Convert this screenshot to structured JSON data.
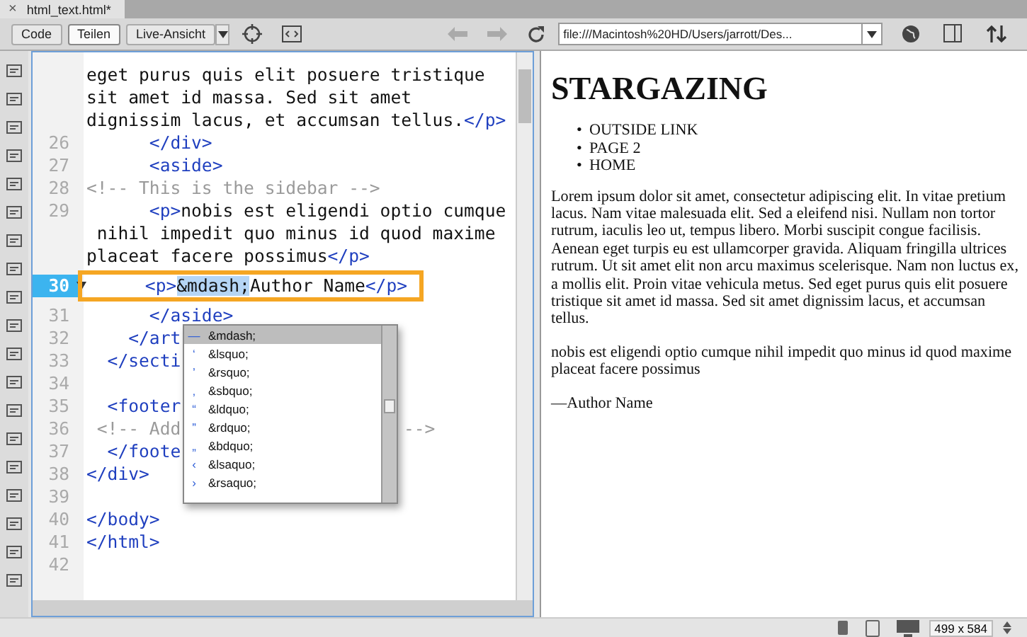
{
  "tab": {
    "close": "×",
    "title": "html_text.html*"
  },
  "toolbar": {
    "buttons": [
      {
        "label": "Code",
        "selected": false
      },
      {
        "label": "Teilen",
        "selected": true
      },
      {
        "label": "Live-Ansicht",
        "selected": false
      }
    ],
    "address": "file:///Macintosh%20HD/Users/jarrott/Des..."
  },
  "code": {
    "lines": [
      {
        "current": false,
        "segments": [
          {
            "kind": "text",
            "text": "eget purus quis elit posuere tristique"
          }
        ]
      },
      {
        "current": false,
        "segments": [
          {
            "kind": "text",
            "text": "sit amet id massa. Sed sit amet"
          }
        ]
      },
      {
        "current": false,
        "segments": [
          {
            "kind": "text",
            "text": "dignissim lacus, et accumsan tellus."
          },
          {
            "kind": "tag",
            "text": "</p>"
          }
        ]
      },
      {
        "number": "26",
        "current": false,
        "segments": [
          {
            "kind": "tag",
            "text": "      </div>"
          }
        ]
      },
      {
        "number": "27",
        "current": false,
        "segments": [
          {
            "kind": "tag",
            "text": "      <aside>"
          }
        ]
      },
      {
        "number": "28",
        "current": false,
        "segments": [
          {
            "kind": "comment",
            "text": "<!-- This is the sidebar -->"
          }
        ]
      },
      {
        "number": "29",
        "current": false,
        "segments": [
          {
            "kind": "tag",
            "text": "      <p>"
          },
          {
            "kind": "text",
            "text": "nobis est eligendi optio cumque"
          }
        ]
      },
      {
        "current": false,
        "segments": [
          {
            "kind": "text",
            "text": " nihil impedit quo minus id quod maxime"
          }
        ]
      },
      {
        "current": false,
        "segments": [
          {
            "kind": "text",
            "text": "placeat facere possimus"
          },
          {
            "kind": "tag",
            "text": "</p>"
          }
        ]
      },
      {
        "number": "30",
        "current": true,
        "boxed": true,
        "segments": [
          {
            "kind": "tag",
            "text": "      <p>"
          },
          {
            "kind": "selection",
            "text": "&mdash;"
          },
          {
            "kind": "text",
            "text": "Author Name"
          },
          {
            "kind": "tag",
            "text": "</p>"
          }
        ]
      },
      {
        "number": "31",
        "current": false,
        "segments": [
          {
            "kind": "tag",
            "text": "      </aside>"
          }
        ]
      },
      {
        "number": "32",
        "current": false,
        "segments": [
          {
            "kind": "tag",
            "text": "    </art"
          }
        ]
      },
      {
        "number": "33",
        "current": false,
        "segments": [
          {
            "kind": "tag",
            "text": "  </secti"
          }
        ]
      },
      {
        "number": "34",
        "current": false
      },
      {
        "number": "35",
        "current": false,
        "segments": [
          {
            "kind": "tag",
            "text": "  <footer"
          }
        ]
      },
      {
        "number": "36",
        "current": false,
        "segments": [
          {
            "kind": "comment",
            "text": " <!-- Add"
          }
        ],
        "tail": {
          "kind": "comment",
          "text": "-->"
        }
      },
      {
        "number": "37",
        "current": false,
        "segments": [
          {
            "kind": "tag",
            "text": "  </foote"
          }
        ]
      },
      {
        "number": "38",
        "current": false,
        "segments": [
          {
            "kind": "tag",
            "text": "</div>"
          }
        ]
      },
      {
        "number": "39",
        "current": false
      },
      {
        "number": "40",
        "current": false,
        "segments": [
          {
            "kind": "tag",
            "text": "</body>"
          }
        ]
      },
      {
        "number": "41",
        "current": false,
        "segments": [
          {
            "kind": "tag",
            "text": "</html>"
          }
        ]
      },
      {
        "number": "42",
        "current": false
      }
    ],
    "hints": [
      {
        "glyph": "—",
        "entity": "&mdash;",
        "selected": true
      },
      {
        "glyph": "‘",
        "entity": "&lsquo;",
        "selected": false
      },
      {
        "glyph": "’",
        "entity": "&rsquo;",
        "selected": false
      },
      {
        "glyph": "‚",
        "entity": "&sbquo;",
        "selected": false
      },
      {
        "glyph": "“",
        "entity": "&ldquo;",
        "selected": false
      },
      {
        "glyph": "”",
        "entity": "&rdquo;",
        "selected": false
      },
      {
        "glyph": "„",
        "entity": "&bdquo;",
        "selected": false
      },
      {
        "glyph": "‹",
        "entity": "&lsaquo;",
        "selected": false
      },
      {
        "glyph": "›",
        "entity": "&rsaquo;",
        "selected": false
      }
    ]
  },
  "preview": {
    "heading": "STARGAZING",
    "nav": [
      {
        "marker": "•",
        "label": "OUTSIDE LINK"
      },
      {
        "marker": "•",
        "label": "PAGE 2"
      },
      {
        "marker": "•",
        "label": "HOME"
      }
    ],
    "paragraphs": [
      "Lorem ipsum dolor sit amet, consectetur adipiscing elit. In vitae pretium lacus. Nam vitae malesuada elit. Sed a eleifend nisi. Nullam non tortor rutrum, iaculis leo ut, tempus libero. Morbi suscipit congue facilisis. Aenean eget turpis eu est ullamcorper gravida. Aliquam fringilla ultrices rutrum. Ut sit amet elit non arcu maximus scelerisque. Nam non luctus ex, a mollis elit. Proin vitae vehicula metus. Sed eget purus quis elit posuere tristique sit amet id massa. Sed sit amet dignissim lacus, et accumsan tellus.",
      "nobis est eligendi optio cumque nihil impedit quo minus id quod maxime placeat facere possimus",
      "—Author Name"
    ]
  },
  "status_bar": {
    "size": "499 x 584"
  }
}
